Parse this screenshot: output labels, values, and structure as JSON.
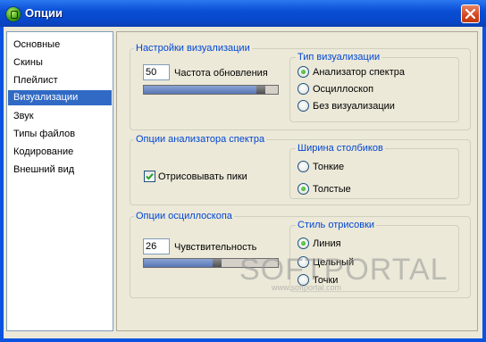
{
  "window": {
    "title": "Опции"
  },
  "sidebar": {
    "items": [
      {
        "label": "Основные"
      },
      {
        "label": "Скины"
      },
      {
        "label": "Плейлист"
      },
      {
        "label": "Визуализации",
        "selected": true
      },
      {
        "label": "Звук"
      },
      {
        "label": "Типы файлов"
      },
      {
        "label": "Кодирование"
      },
      {
        "label": "Внешний вид"
      }
    ]
  },
  "visualization_settings": {
    "title": "Настройки визуализации",
    "refresh_value": "50",
    "refresh_label": "Частота обновления",
    "refresh_slider_level": 0.9
  },
  "visualization_type": {
    "title": "Тип визуализации",
    "options": [
      "Анализатор спектра",
      "Осциллоскоп",
      "Без визуализации"
    ],
    "selected": "Анализатор спектра"
  },
  "spectrum_options": {
    "title": "Опции анализатора спектра",
    "draw_peaks_label": "Отрисовывать пики",
    "draw_peaks_checked": true
  },
  "bar_width": {
    "title": "Ширина столбиков",
    "options": [
      "Тонкие",
      "Толстые"
    ],
    "selected": "Толстые"
  },
  "oscilloscope_options": {
    "title": "Опции осциллоскопа",
    "sensitivity_value": "26",
    "sensitivity_label": "Чувствительность",
    "sensitivity_slider_level": 0.55
  },
  "draw_style": {
    "title": "Стиль отрисовки",
    "options": [
      "Линия",
      "Цельный",
      "Точки"
    ],
    "selected": "Линия"
  },
  "watermark": {
    "brand": "SOFTPORTAL",
    "url": "www.softportal.com"
  },
  "colors": {
    "titlebar": "#0a4fd6",
    "selected_item": "#316ac5",
    "group_title": "#0046d5",
    "dialog_bg": "#ece9d8"
  }
}
